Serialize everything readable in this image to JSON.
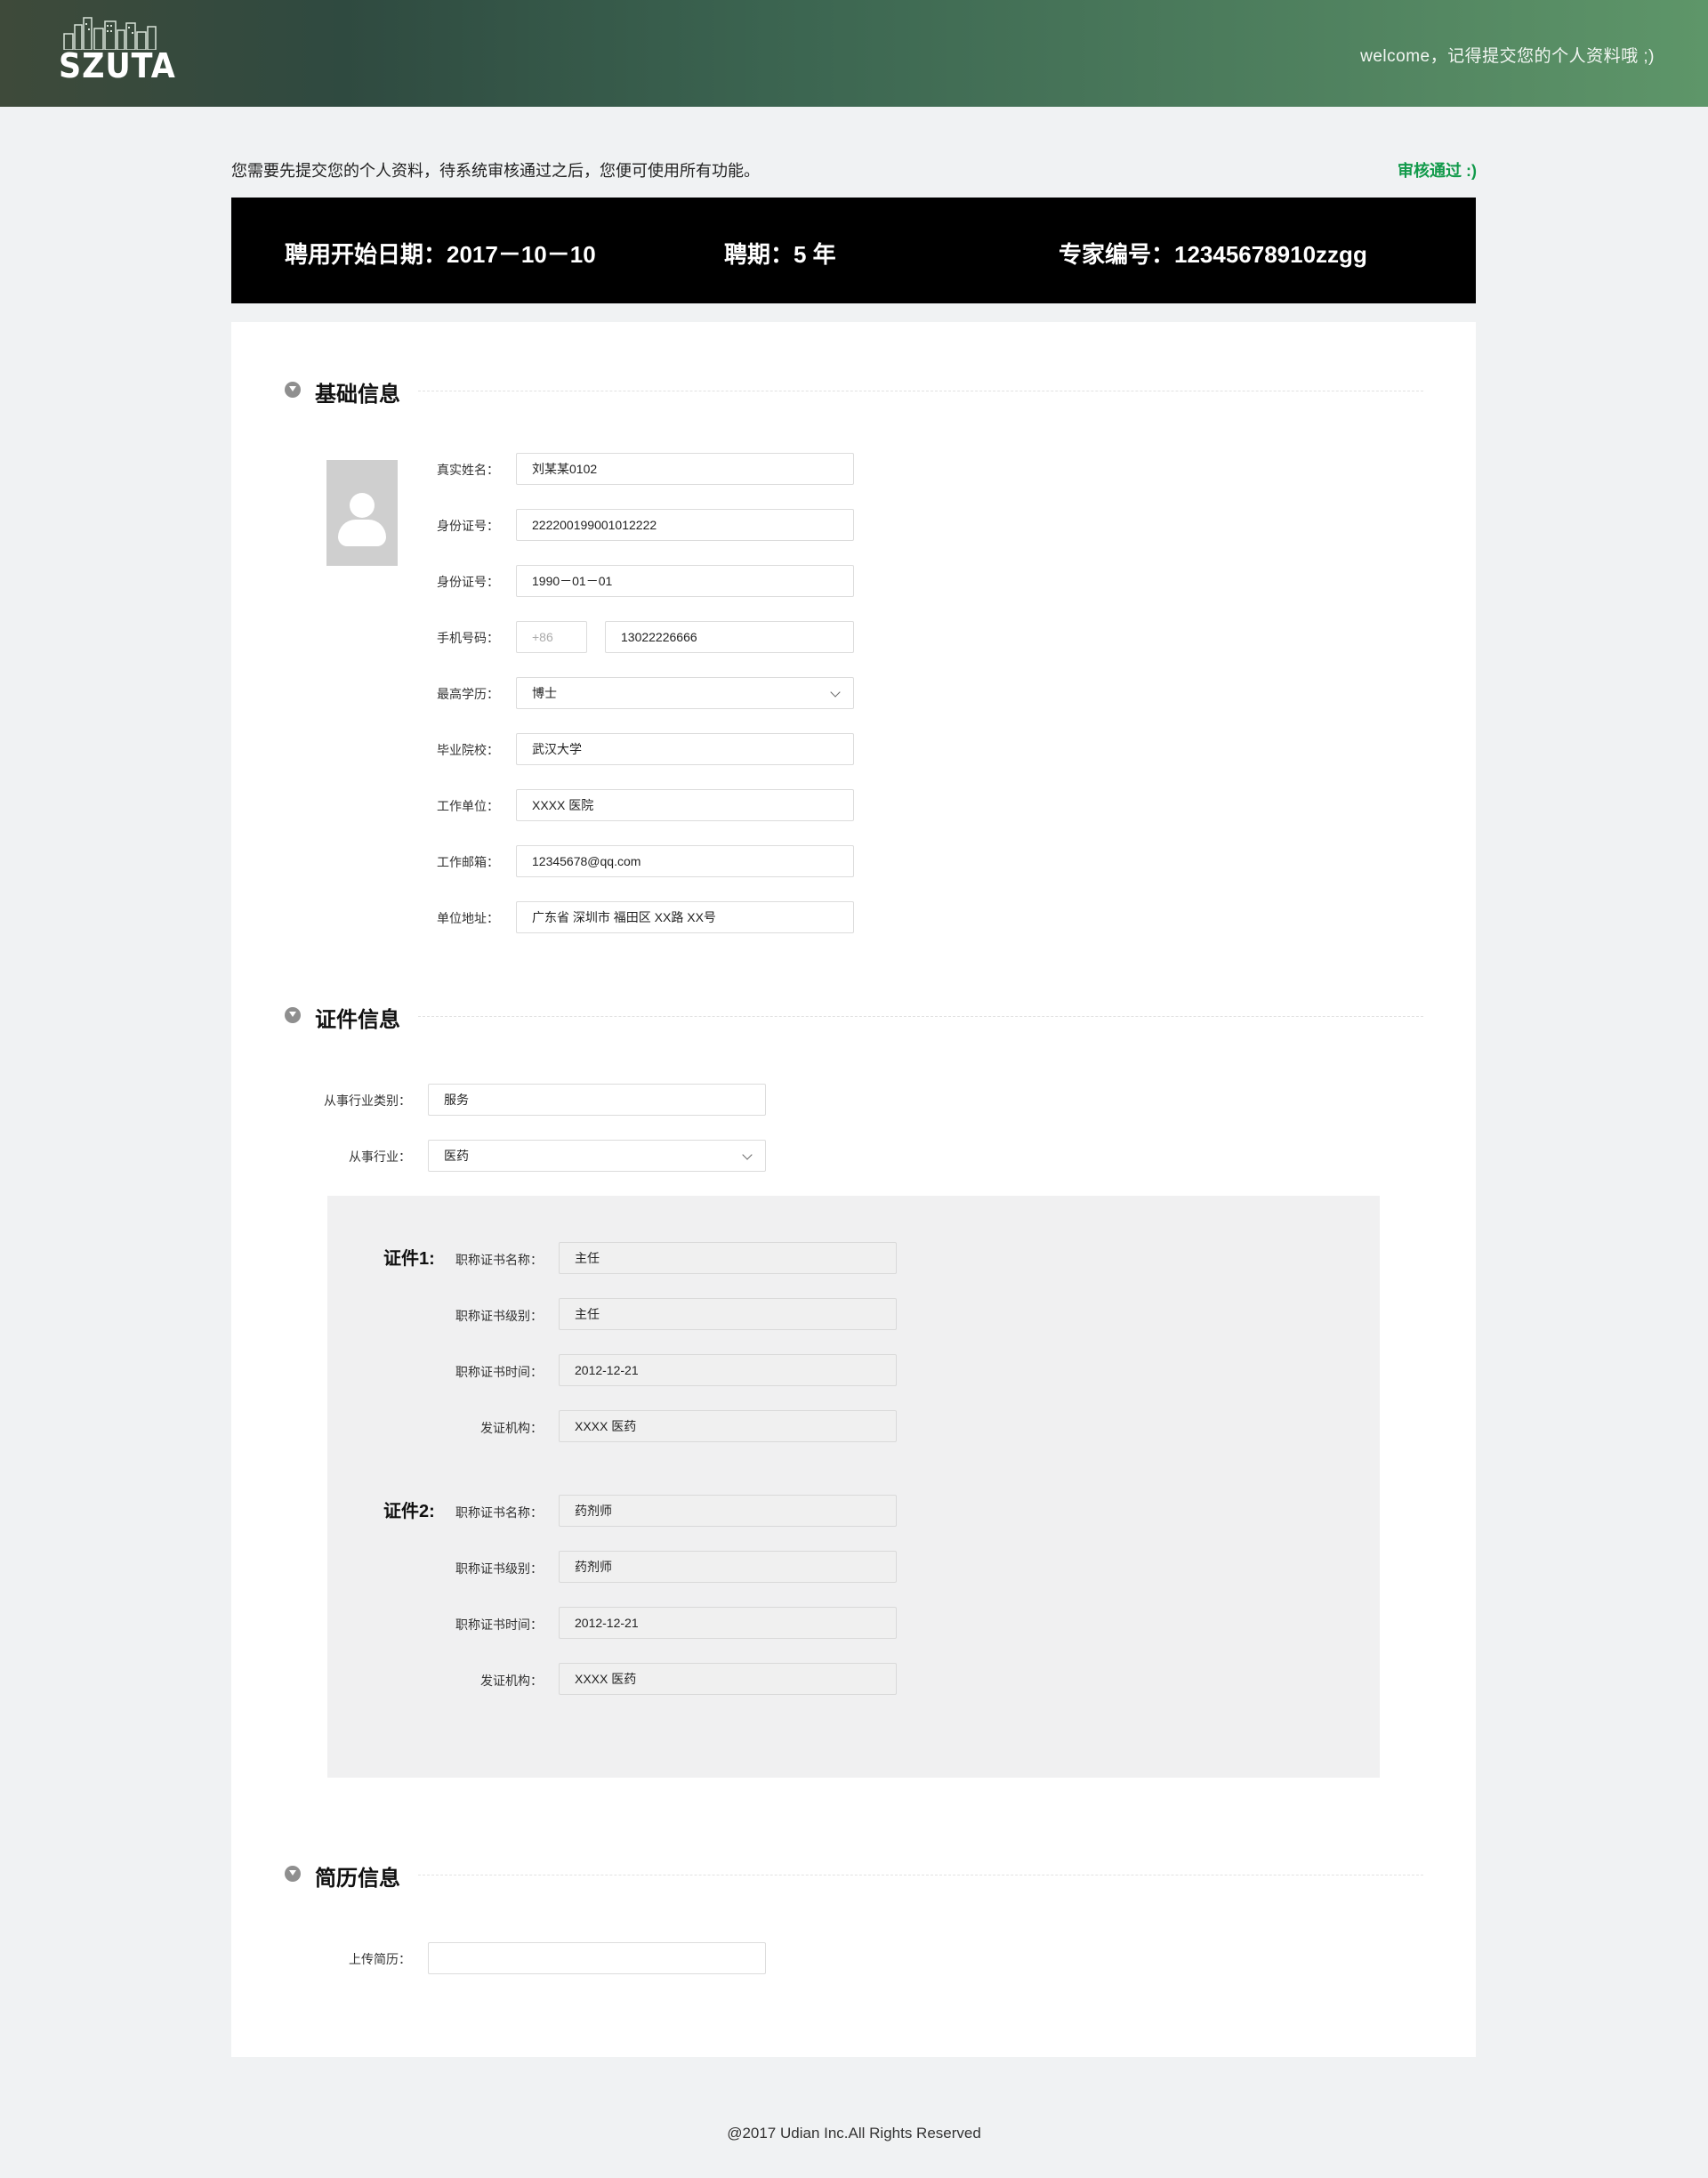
{
  "header": {
    "logo_text": "SZUTA",
    "welcome": "welcome，记得提交您的个人资料哦 ;)"
  },
  "notice": {
    "text": "您需要先提交您的个人资料，待系统审核通过之后，您便可使用所有功能。",
    "status": "审核通过 :)"
  },
  "info_bar": {
    "start_date": "聘用开始日期：2017－10－10",
    "term": "聘期：5 年",
    "expert_no": "专家编号：12345678910zzgg"
  },
  "basic": {
    "title": "基础信息",
    "fields": [
      {
        "label": "真实姓名：",
        "value": "刘某某0102"
      },
      {
        "label": "身份证号：",
        "value": "222200199001012222"
      },
      {
        "label": "身份证号：",
        "value": "1990－01－01"
      },
      {
        "label": "手机号码：",
        "prefix": "+86",
        "value": "13022226666"
      },
      {
        "label": "最高学历：",
        "value": "博士"
      },
      {
        "label": "毕业院校：",
        "value": "武汉大学"
      },
      {
        "label": "工作单位：",
        "value": "XXXX 医院"
      },
      {
        "label": "工作邮箱：",
        "value": "12345678@qq.com"
      },
      {
        "label": "单位地址：",
        "value": "广东省 深圳市 福田区 XX路 XX号"
      }
    ]
  },
  "cert": {
    "title": "证件信息",
    "industry_type_label": "从事行业类别：",
    "industry_type": "服务",
    "industry_label": "从事行业：",
    "industry": "医药",
    "items": [
      {
        "title": "证件1:",
        "fields": [
          {
            "label": "职称证书名称：",
            "value": "主任"
          },
          {
            "label": "职称证书级别：",
            "value": "主任"
          },
          {
            "label": "职称证书时间：",
            "value": "2012-12-21"
          },
          {
            "label": "发证机构：",
            "value": "XXXX 医药"
          }
        ]
      },
      {
        "title": "证件2:",
        "fields": [
          {
            "label": "职称证书名称：",
            "value": "药剂师"
          },
          {
            "label": "职称证书级别：",
            "value": "药剂师"
          },
          {
            "label": "职称证书时间：",
            "value": "2012-12-21"
          },
          {
            "label": "发证机构：",
            "value": "XXXX 医药"
          }
        ]
      }
    ]
  },
  "resume": {
    "title": "简历信息",
    "upload_label": "上传简历：",
    "upload_value": ""
  },
  "footer": "@2017 Udian Inc.All Rights Reserved"
}
